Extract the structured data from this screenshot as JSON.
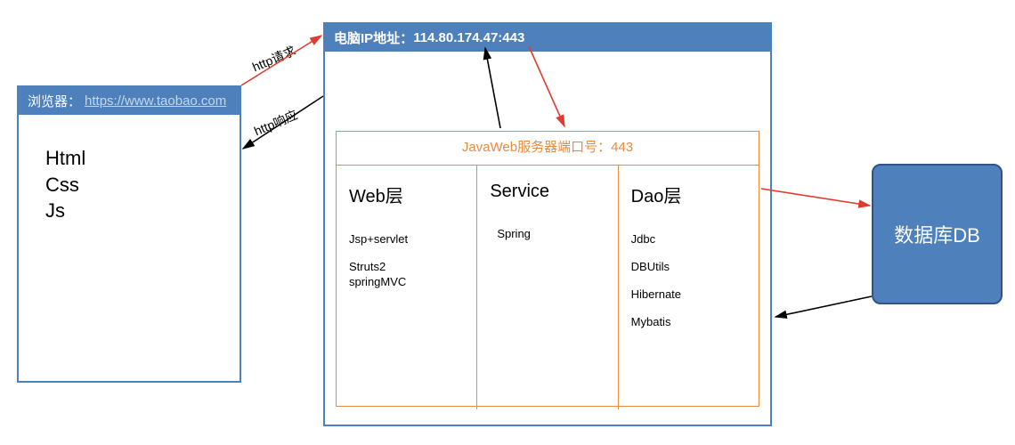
{
  "browser": {
    "label": "浏览器：",
    "url": "https://www.taobao.com",
    "body_lines": [
      "Html",
      "Css",
      "Js"
    ]
  },
  "server": {
    "header_label": "电脑IP地址：",
    "header_value": "114.80.174.47:443",
    "javaweb_title": "JavaWeb服务器端口号：443",
    "layers": {
      "web": {
        "title": "Web层",
        "items": [
          "Jsp+servlet",
          "Struts2\nspringMVC"
        ]
      },
      "service": {
        "title": "Service",
        "items": [
          "Spring"
        ]
      },
      "dao": {
        "title": "Dao层",
        "items": [
          "Jdbc",
          "DBUtils",
          "Hibernate",
          "Mybatis"
        ]
      }
    }
  },
  "db": {
    "label": "数据库DB"
  },
  "edges": {
    "request": "http请求",
    "response": "http响应"
  },
  "colors": {
    "accent_blue": "#4E80BC",
    "accent_orange": "#E88B3E",
    "arrow_red": "#E03B2E",
    "arrow_black": "#000000"
  }
}
